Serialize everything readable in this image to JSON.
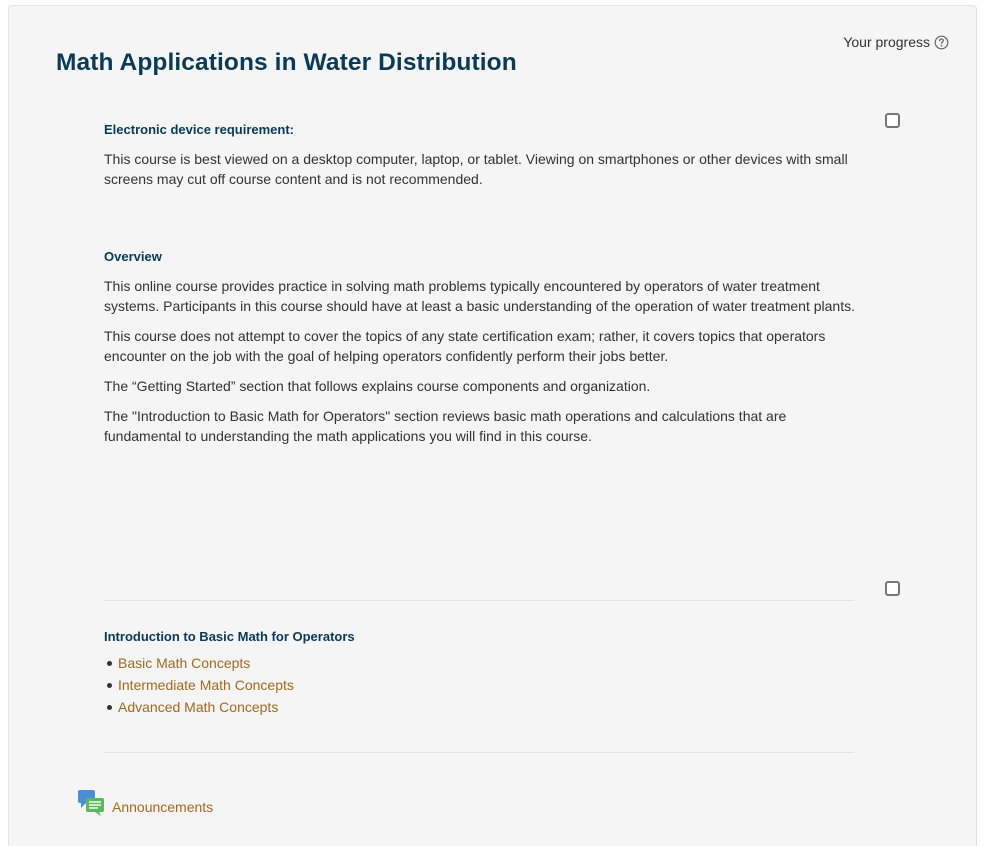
{
  "header": {
    "progress_label": "Your progress",
    "title": "Math Applications in Water Distribution"
  },
  "device_section": {
    "heading": "Electronic device requirement:",
    "text": "This course is best viewed on a desktop computer, laptop, or tablet. Viewing on smartphones or other devices with small screens may cut off course content and is not recommended."
  },
  "overview_section": {
    "heading": "Overview",
    "paragraphs": [
      "This online course provides practice in solving math problems typically encountered by operators of water treatment systems. Participants in this course should have at least a basic understanding of the operation of water treatment plants.",
      "This course does not attempt to cover the topics of any state certification exam; rather, it covers topics that operators encounter on the job with the goal of helping operators confidently perform their jobs better.",
      "The “Getting Started” section that follows explains course components and organization.",
      "The \"Introduction to Basic Math for Operators\" section reviews basic math operations and calculations that are fundamental to understanding the math applications you will find in this course."
    ]
  },
  "intro_section": {
    "heading": "Introduction to Basic Math for Operators",
    "links": [
      "Basic Math Concepts",
      "Intermediate Math Concepts",
      "Advanced Math Concepts"
    ]
  },
  "announcements": {
    "label": "Announcements",
    "icon": "forum-icon"
  },
  "colors": {
    "title": "#0a3a57",
    "link": "#a26a1f",
    "panel_bg": "#f5f5f5"
  }
}
